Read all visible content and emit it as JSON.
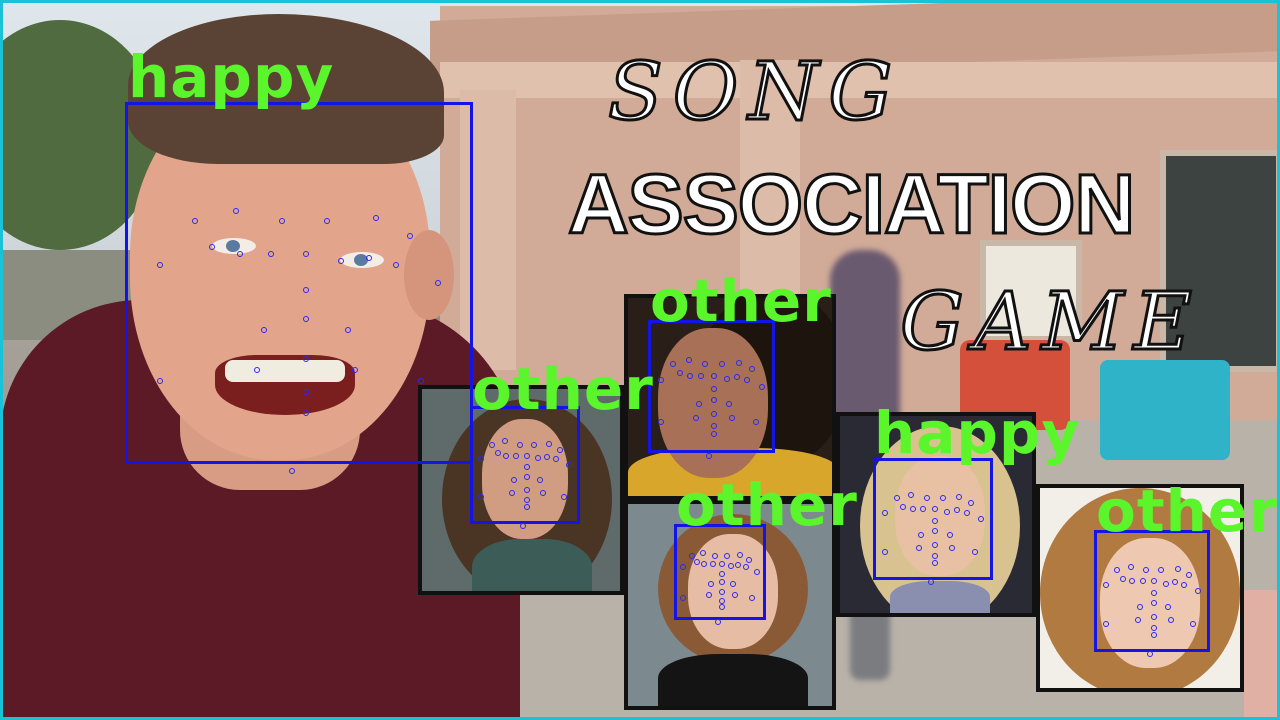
{
  "title": {
    "line1": "SONG",
    "line2": "ASSOCIATION",
    "line3": "GAME"
  },
  "detections": [
    {
      "label": "happy"
    },
    {
      "label": "other"
    },
    {
      "label": "other"
    },
    {
      "label": "other"
    },
    {
      "label": "happy"
    },
    {
      "label": "other"
    }
  ],
  "colors": {
    "border": "#19c2d6",
    "box": "#1414e6",
    "label": "#5af52a"
  }
}
